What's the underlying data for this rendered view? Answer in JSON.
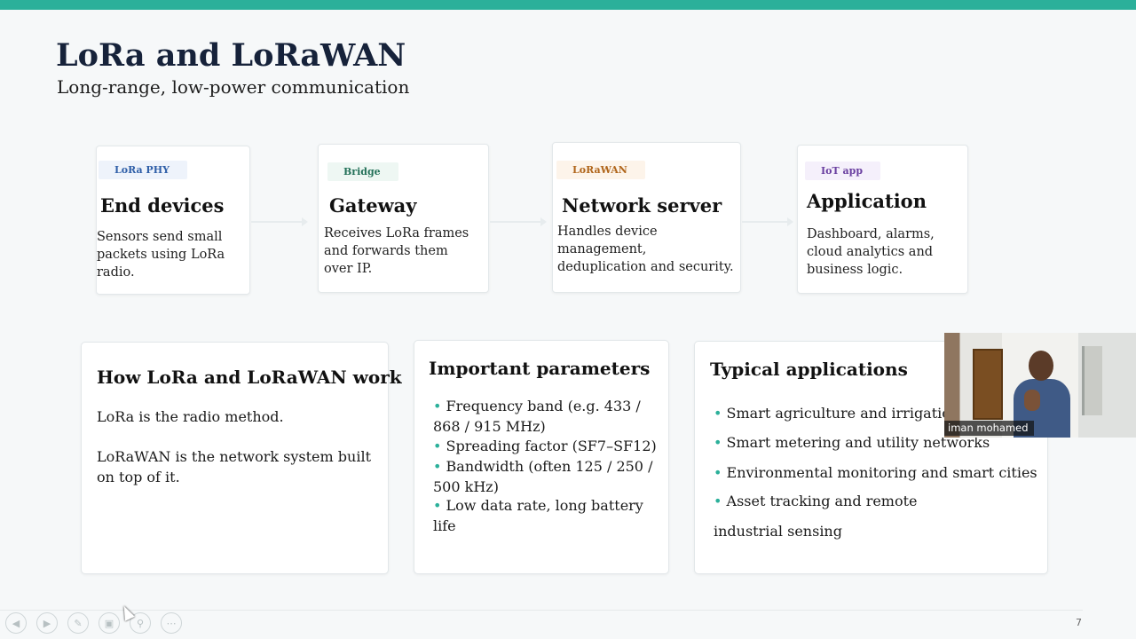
{
  "slide": {
    "title": "LoRa and LoRaWAN",
    "subtitle": "Long-range, low-power communication",
    "page_number": "7"
  },
  "flow": [
    {
      "chip": "LoRa PHY",
      "heading": "End devices",
      "desc": "Sensors send small packets using LoRa radio."
    },
    {
      "chip": "Bridge",
      "heading": "Gateway",
      "desc": "Receives LoRa frames and forwards them over IP."
    },
    {
      "chip": "LoRaWAN",
      "heading": "Network server",
      "desc": "Handles device management, deduplication and security."
    },
    {
      "chip": "IoT app",
      "heading": "Application",
      "desc": "Dashboard, alarms, cloud analytics and business logic."
    }
  ],
  "panels": {
    "how": {
      "heading": "How LoRa and LoRaWAN work",
      "p1": "LoRa is the radio method.",
      "p2": "LoRaWAN is the network system built on top of it."
    },
    "params": {
      "heading": "Important parameters",
      "items": [
        "Frequency band (e.g. 433 / 868 / 915 MHz)",
        "Spreading factor (SF7–SF12)",
        "Bandwidth (often 125 / 250 / 500 kHz)",
        "Low data rate, long battery life"
      ]
    },
    "apps": {
      "heading": "Typical applications",
      "items": [
        "Smart agriculture and irrigation",
        "Smart metering and utility networks",
        "Environmental monitoring and smart cities",
        "Asset tracking and remote industrial sensing"
      ]
    }
  },
  "video": {
    "participant_name": "iman mohamed"
  },
  "toolbar": {
    "icons": [
      "previous-icon",
      "play-icon",
      "pen-icon",
      "slides-icon",
      "zoom-icon",
      "more-icon"
    ]
  },
  "colors": {
    "accent": "#2bb09a",
    "title": "#16223a",
    "chip_phy_bg": "#eef3fb",
    "chip_phy_fg": "#2f5fa8",
    "chip_bridge_bg": "#eef7f3",
    "chip_bridge_fg": "#25725a",
    "chip_lorawan_bg": "#fdf4ea",
    "chip_lorawan_fg": "#b0651a",
    "chip_iot_bg": "#f5f0fb",
    "chip_iot_fg": "#6a3fa0"
  }
}
